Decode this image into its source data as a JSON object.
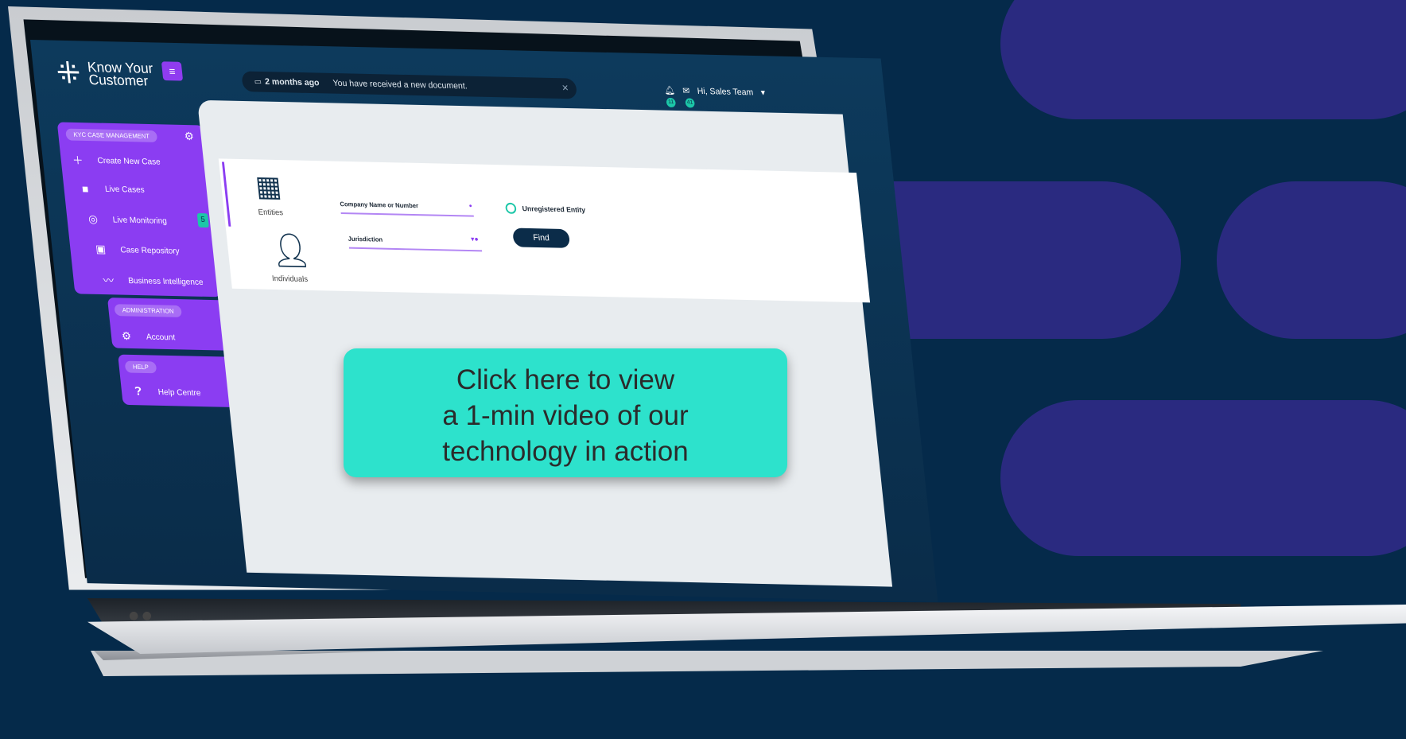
{
  "brand": {
    "name_line1": "Know Your",
    "name_line2": "Customer"
  },
  "notification": {
    "when": "2 months ago",
    "message": "You have received a new document."
  },
  "header": {
    "greeting": "Hi, Sales Team",
    "bell_count": "11",
    "mail_count": "41"
  },
  "sidebar": {
    "case_section": "KYC CASE MANAGEMENT",
    "items": [
      {
        "label": "Create New Case",
        "icon": "plus-icon"
      },
      {
        "label": "Live Cases",
        "icon": "folder-icon"
      },
      {
        "label": "Live Monitoring",
        "icon": "radar-icon",
        "badge": "5"
      },
      {
        "label": "Case Repository",
        "icon": "archive-icon"
      },
      {
        "label": "Business Intelligence",
        "icon": "trend-icon"
      }
    ],
    "admin_section": "ADMINISTRATION",
    "admin_items": [
      {
        "label": "Account",
        "icon": "gear-icon"
      }
    ],
    "help_section": "HELP",
    "help_items": [
      {
        "label": "Help Centre",
        "icon": "question-icon"
      }
    ]
  },
  "search": {
    "tabs": [
      {
        "label": "Entities",
        "icon": "building-icon"
      },
      {
        "label": "Individuals",
        "icon": "person-icon"
      }
    ],
    "company_field": "Company Name or Number",
    "jurisdiction_field": "Jurisdiction",
    "unregistered_label": "Unregistered Entity",
    "find_label": "Find"
  },
  "cta": {
    "line1": "Click here to view",
    "line2": "a 1-min video of our",
    "line3": "technology in action"
  },
  "colors": {
    "background": "#052a4a",
    "accent": "#8b3df2",
    "cta": "#2de2cc",
    "pill": "#2a2a80"
  }
}
